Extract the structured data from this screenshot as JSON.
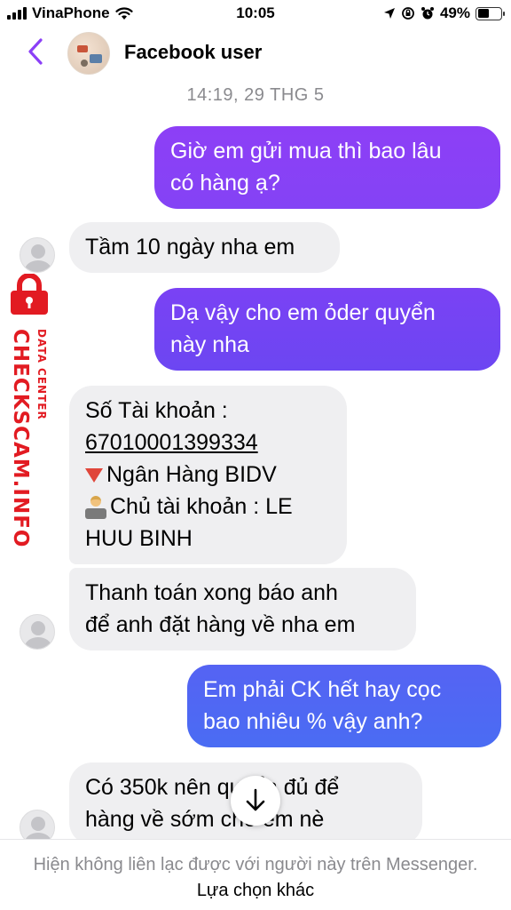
{
  "status": {
    "carrier": "VinaPhone",
    "time": "10:05",
    "battery": "49%",
    "battery_level": 0.49
  },
  "header": {
    "contact_name": "Facebook user"
  },
  "conversation": {
    "timestamp": "14:19, 29 THG 5",
    "messages": [
      {
        "from": "me",
        "lines": [
          "Giờ em gửi mua thì bao lâu",
          "có hàng ạ?"
        ]
      },
      {
        "from": "them",
        "lines": [
          "Tầm 10 ngày nha em"
        ]
      },
      {
        "from": "me",
        "lines": [
          "Dạ vậy cho em ỏder quyển",
          "này nha"
        ]
      },
      {
        "from": "them",
        "lines": [
          "Số Tài khoản  :",
          "67010001399334",
          "Ngân Hàng BIDV",
          "Chủ tài khoản : LE",
          "HUU BINH"
        ]
      },
      {
        "from": "them",
        "lines": [
          "Thanh toán xong báo anh",
          "để anh đặt hàng về nha em"
        ]
      },
      {
        "from": "me",
        "lines": [
          "Em phải CK hết hay cọc",
          "bao nhiêu % vậy anh?"
        ]
      },
      {
        "from": "them",
        "lines": [
          "Có 350k nên quyển đủ để",
          "hàng về sớm cho em nè"
        ]
      }
    ]
  },
  "watermark": {
    "main": "CHECKSCAM.INFO",
    "sub": "DATA CENTER"
  },
  "footer": {
    "notice": "Hiện không liên lạc được với người này trên Messenger.",
    "link": "Lựa chọn khác"
  },
  "colors": {
    "bubble_out_top": "#8b3ff7",
    "bubble_out_mid": "#6a45f2",
    "bubble_out_bottom": "#4a6af2",
    "bubble_in": "#efeff1",
    "accent": "#8b3ff7",
    "watermark": "#e21b22"
  }
}
